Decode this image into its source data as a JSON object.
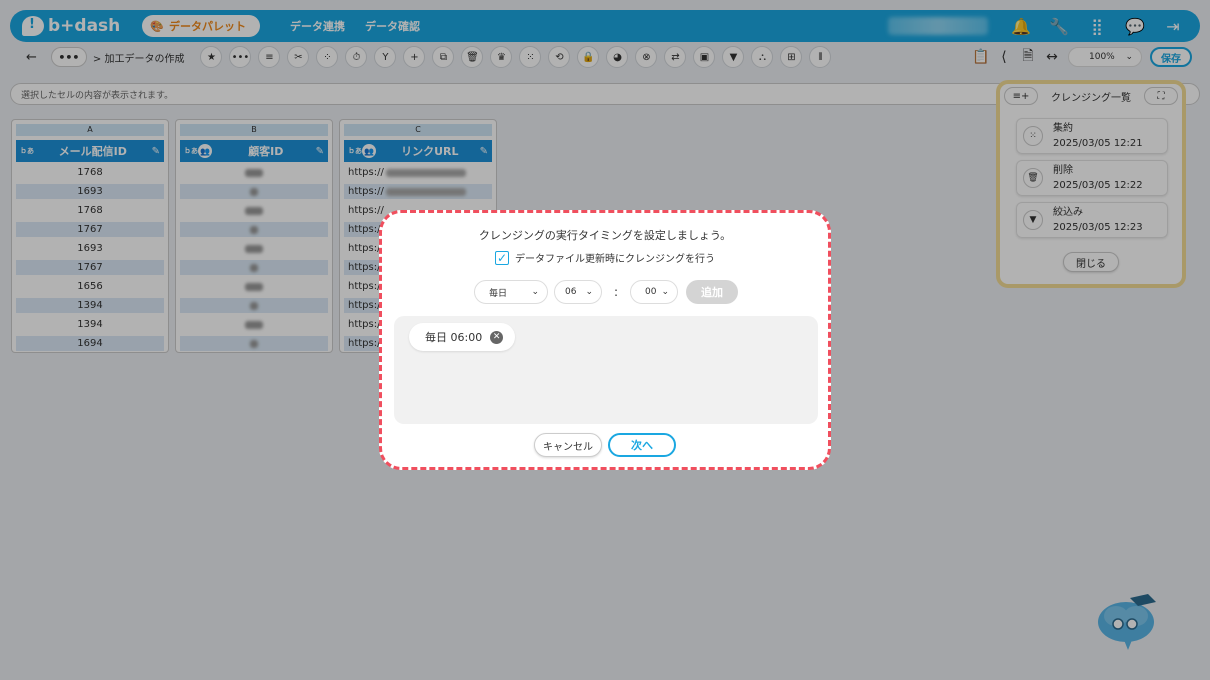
{
  "header": {
    "logo": "b+dash",
    "active_nav": "データパレット",
    "nav_links": [
      "データ連携",
      "データ確認"
    ],
    "icons": [
      "bell-icon",
      "wrench-icon",
      "grid-icon",
      "chat-icon",
      "logout-icon"
    ]
  },
  "toolbar": {
    "more": "•••",
    "breadcrumb": "> 加工データの作成",
    "zoom": "100%",
    "save": "保存"
  },
  "cellbar": {
    "placeholder": "選択したセルの内容が表示されます。"
  },
  "columns": [
    {
      "letter": "A",
      "type": "ｂあ",
      "name": "メール配信ID",
      "rows": [
        "1768",
        "1693",
        "1768",
        "1767",
        "1693",
        "1767",
        "1656",
        "1394",
        "1394",
        "1694"
      ]
    },
    {
      "letter": "B",
      "type": "ｂあ",
      "name": "顧客ID",
      "rows": [
        "",
        "",
        "",
        "",
        "",
        "",
        "",
        "",
        "",
        ""
      ]
    },
    {
      "letter": "C",
      "type": "ｂあ",
      "name": "リンクURL",
      "rows": [
        "https://",
        "https://",
        "https://",
        "https:/",
        "https:/",
        "https:/",
        "https:/",
        "https:/",
        "https:/",
        "https:/"
      ]
    }
  ],
  "panel": {
    "title": "クレンジング一覧",
    "items": [
      {
        "label": "集約",
        "time": "2025/03/05 12:21",
        "icon": "aggregate-icon"
      },
      {
        "label": "削除",
        "time": "2025/03/05 12:22",
        "icon": "trash-icon"
      },
      {
        "label": "絞込み",
        "time": "2025/03/05 12:23",
        "icon": "filter-icon"
      }
    ],
    "close": "閉じる"
  },
  "modal": {
    "title": "クレンジングの実行タイミングを設定しましょう。",
    "checkbox_label": "データファイル更新時にクレンジングを行う",
    "checkbox_checked": true,
    "frequency": "毎日",
    "hour": "06",
    "colon": ":",
    "minute": "00",
    "add": "追加",
    "schedules": [
      "毎日 06:00"
    ],
    "cancel": "キャンセル",
    "next": "次へ"
  },
  "colors": {
    "brand": "#1aa7e1",
    "modal_border": "#f04f5e",
    "panel_border": "#f3dc96"
  }
}
